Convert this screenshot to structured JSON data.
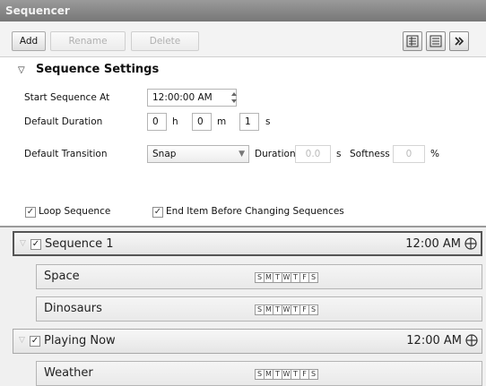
{
  "window": {
    "title": "Sequencer"
  },
  "toolbar": {
    "add_label": "Add",
    "rename_label": "Rename",
    "delete_label": "Delete",
    "icons": [
      "grid-view-icon",
      "list-view-icon",
      "collapse-panel-icon"
    ]
  },
  "settings": {
    "header": "Sequence Settings",
    "start_label": "Start Sequence At",
    "start_value": "12:00:00 AM",
    "duration_label": "Default Duration",
    "duration_h": "0",
    "duration_m": "0",
    "duration_s": "1",
    "unit_h": "h",
    "unit_m": "m",
    "unit_s": "s",
    "transition_label": "Default Transition",
    "transition_value": "Snap",
    "trans_duration_label": "Duration",
    "trans_duration_value": "0.0",
    "trans_duration_unit": "s",
    "softness_label": "Softness",
    "softness_value": "0",
    "softness_unit": "%",
    "loop_label": "Loop Sequence",
    "loop_checked": true,
    "end_item_label": "End Item Before Changing Sequences",
    "end_item_checked": true
  },
  "day_letters": [
    "S",
    "M",
    "T",
    "W",
    "T",
    "F",
    "S"
  ],
  "sequences": [
    {
      "name": "Sequence 1",
      "time": "12:00 AM",
      "checked": true,
      "active": true
    },
    {
      "name": "Playing Now",
      "time": "12:00 AM",
      "checked": true,
      "active": false
    }
  ],
  "items": [
    {
      "name": "Space"
    },
    {
      "name": "Dinosaurs"
    },
    {
      "name": "Weather"
    }
  ],
  "colors": {
    "titlebar": "#888888",
    "divider": "#9b9b9b",
    "list_bg": "#f0f0f0"
  }
}
